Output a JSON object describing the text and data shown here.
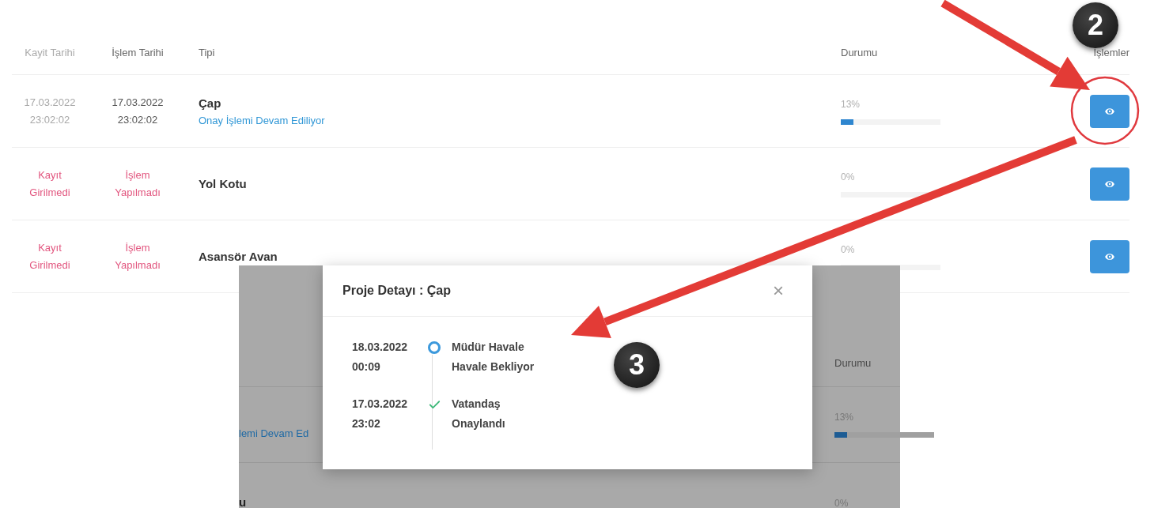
{
  "table": {
    "columns": [
      "Kayit Tarihi",
      "İşlem Tarihi",
      "Tipi",
      "Durumu",
      "İşlemler"
    ],
    "rows": [
      {
        "registered": {
          "kind": "date",
          "lines": [
            "17.03.2022",
            "23:02:02"
          ]
        },
        "processed": {
          "kind": "date",
          "lines": [
            "17.03.2022",
            "23:02:02"
          ]
        },
        "type": "Çap",
        "status": "Onay İşlemi Devam Ediliyor",
        "reading": "13%",
        "level": 0.13
      },
      {
        "registered": {
          "kind": "missing",
          "lines": [
            "Kayıt",
            "Girilmedi"
          ]
        },
        "processed": {
          "kind": "missing",
          "lines": [
            "İşlem",
            "Yapılmadı"
          ]
        },
        "type": "Yol Kotu",
        "reading": "0%",
        "level": 0
      },
      {
        "registered": {
          "kind": "missing",
          "lines": [
            "Kayıt",
            "Girilmedi"
          ]
        },
        "processed": {
          "kind": "missing",
          "lines": [
            "İşlem",
            "Yapılmadı"
          ]
        },
        "type": "Asansör Avan",
        "reading": "0%",
        "level": 0
      }
    ]
  },
  "inset": {
    "header": "Durumu",
    "rows": [
      {
        "kind": "status",
        "fragment": "lemi Devam Ed",
        "reading": "13%",
        "level": 0.13
      },
      {
        "kind": "title",
        "fragment": "u",
        "reading": "0%"
      }
    ]
  },
  "modal": {
    "title": "Proje Detayı : Çap",
    "close": "×",
    "timeline": [
      {
        "date": "18.03.2022",
        "time": "00:09",
        "title": "Müdür Havale",
        "status": "Havale Bekliyor",
        "kind": "pending"
      },
      {
        "date": "17.03.2022",
        "time": "23:02",
        "title": "Vatandaş",
        "status": "Onaylandı",
        "kind": "done"
      }
    ]
  },
  "annotations": {
    "badges": [
      "2",
      "3"
    ]
  }
}
